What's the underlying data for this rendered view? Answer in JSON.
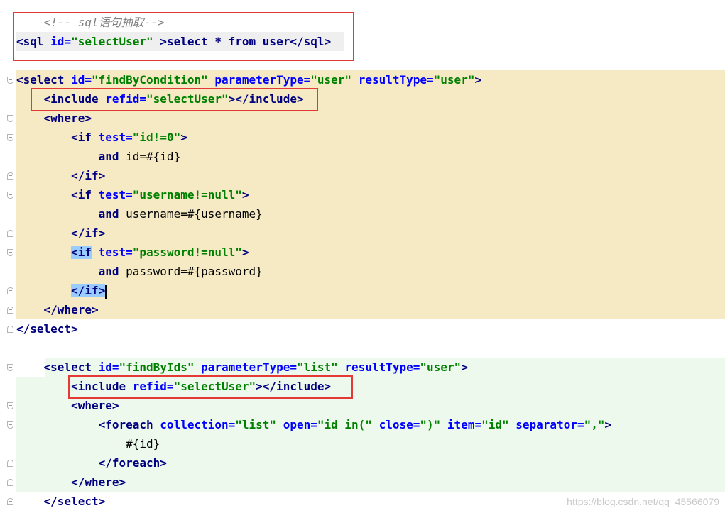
{
  "editor": {
    "language": "xml",
    "highlight_color": "#e53935",
    "watermark": "https://blog.csdn.net/qq_45566079"
  },
  "code": {
    "l1": {
      "a": "<!-- sql",
      "b": "语句抽取",
      "c": "-->"
    },
    "l2": {
      "a": "<sql",
      "b": "id=",
      "c": "\"selectUser\"",
      "d": " >",
      "e": "select * from user",
      "f": "</sql>"
    },
    "l4": {
      "a": "<select",
      "b": "id=",
      "c": "\"findByCondition\"",
      "d": "parameterType=",
      "e": "\"user\"",
      "f": "resultType=",
      "g": "\"user\"",
      "h": ">"
    },
    "l5": {
      "a": "<include",
      "b": "refid=",
      "c": "\"selectUser\"",
      "d": "></include>"
    },
    "l6": {
      "a": "<where>"
    },
    "l7": {
      "a": "<if",
      "b": "test=",
      "c": "\"id!=0\"",
      "d": ">"
    },
    "l8": {
      "a": "and",
      "b": " id=#{id}"
    },
    "l9": {
      "a": "</if>"
    },
    "l10": {
      "a": "<if",
      "b": "test=",
      "c": "\"username!=null\"",
      "d": ">"
    },
    "l11": {
      "a": "and",
      "b": " username=#{username}"
    },
    "l12": {
      "a": "</if>"
    },
    "l13": {
      "a": "<if",
      "b": "test=",
      "c": "\"password!=null\"",
      "d": ">"
    },
    "l14": {
      "a": "and",
      "b": " password=#{password}"
    },
    "l15": {
      "a": "</if>"
    },
    "l16": {
      "a": "</where>"
    },
    "l17": {
      "a": "</select>"
    },
    "l19": {
      "a": "<select",
      "b": "id=",
      "c": "\"findByIds\"",
      "d": "parameterType=",
      "e": "\"list\"",
      "f": "resultType=",
      "g": "\"user\"",
      "h": ">"
    },
    "l20": {
      "a": "<include",
      "b": "refid=",
      "c": "\"selectUser\"",
      "d": "></include>"
    },
    "l21": {
      "a": "<where>"
    },
    "l22": {
      "a": "<foreach",
      "b": "collection=",
      "c": "\"list\"",
      "d": "open=",
      "e": "\"id in(\"",
      "f": "close=",
      "g": "\")\"",
      "h": "item=",
      "i": "\"id\"",
      "j": "separator=",
      "k": "\",\"",
      "l": ">"
    },
    "l23": {
      "a": "#{id}"
    },
    "l24": {
      "a": "</foreach>"
    },
    "l25": {
      "a": "</where>"
    },
    "l26": {
      "a": "</select>"
    }
  }
}
